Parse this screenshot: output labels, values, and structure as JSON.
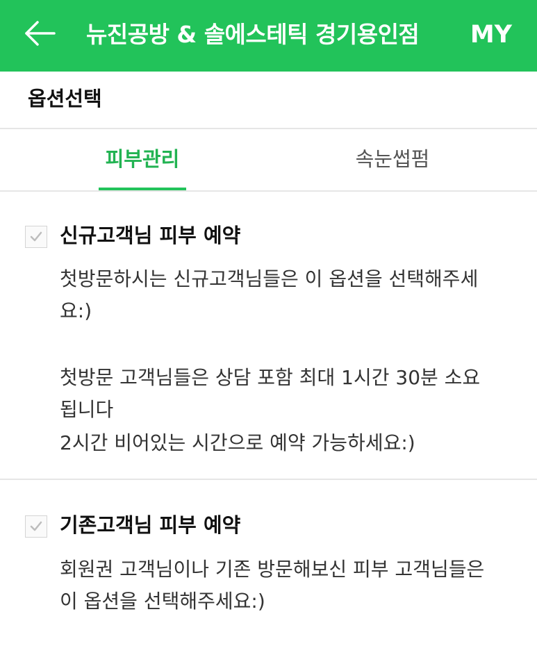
{
  "header": {
    "title": "뉴진공방 & 솔에스테틱 경기용인점",
    "my_label": "MY",
    "background_color": "#22c35a"
  },
  "section": {
    "title": "옵션선택"
  },
  "tabs": [
    {
      "label": "피부관리",
      "active": true
    },
    {
      "label": "속눈썹펌",
      "active": false
    }
  ],
  "options": [
    {
      "title": "신규고객님 피부 예약",
      "description_lines": [
        "첫방문하시는 신규고객님들은 이 옵션을 선택해주세",
        "요:)",
        "첫방문 고객님들은 상담 포함 최대 1시간 30분 소요",
        "됩니다",
        "2시간 비어있는 시간으로 예약 가능하세요:)"
      ]
    },
    {
      "title": "기존고객님 피부 예약",
      "description_lines": [
        "회원권 고객님이나 기존 방문해보신 피부 고객님들은",
        "이 옵션을 선택해주세요:)"
      ]
    }
  ],
  "icons": {
    "back": "back-arrow-icon",
    "check": "checkmark-icon"
  },
  "colors": {
    "accent": "#22c35a",
    "active_tab_text": "#22b352"
  }
}
